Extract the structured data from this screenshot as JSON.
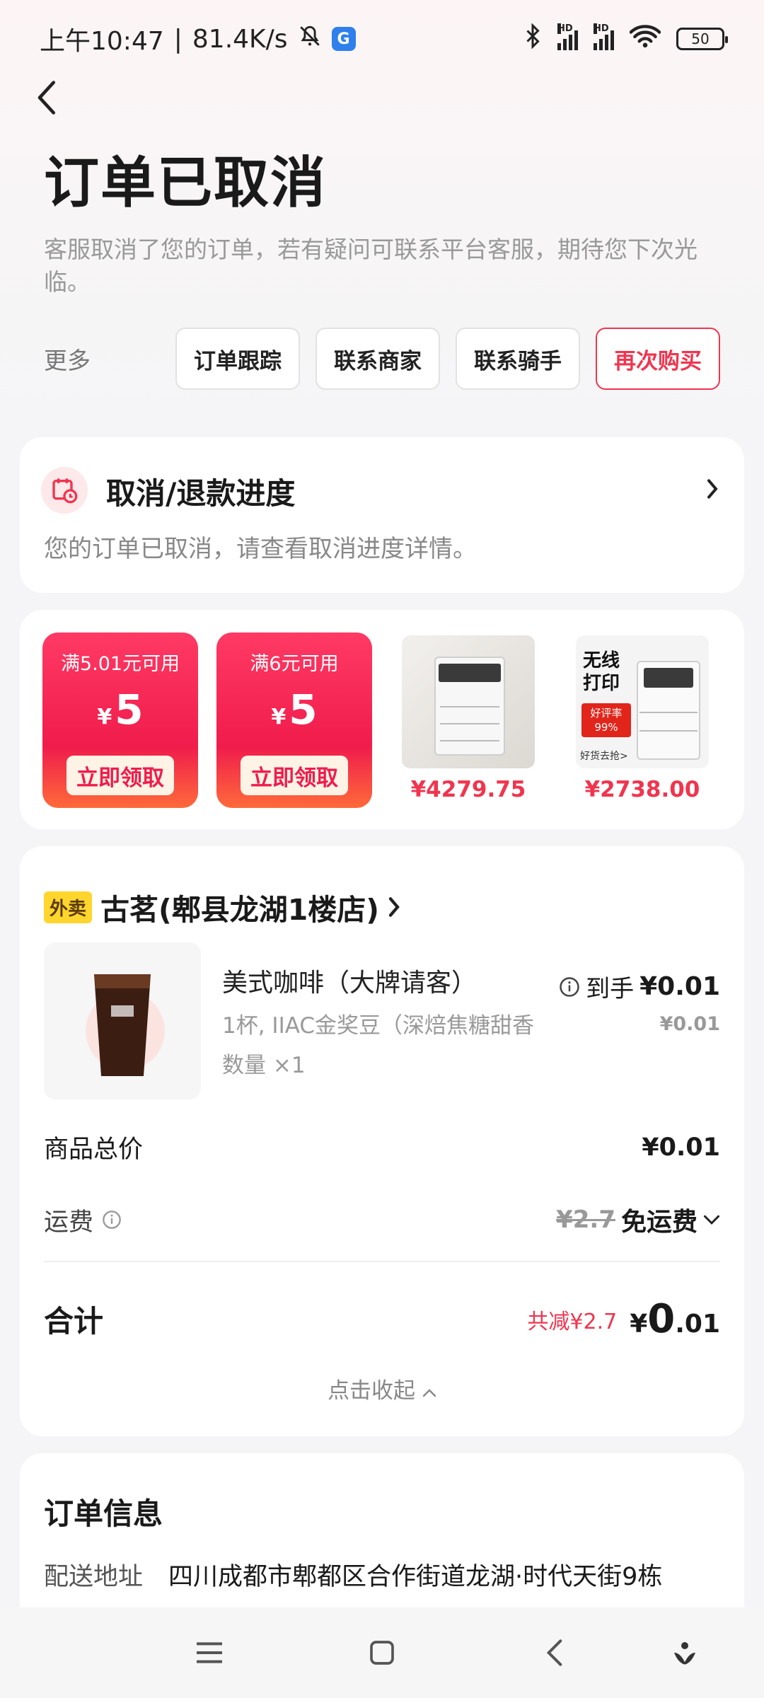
{
  "status_bar": {
    "time": "上午10:47",
    "net_speed": "81.4K/s",
    "battery": "50",
    "icons": [
      "bell-off-icon",
      "app-icon",
      "bluetooth-icon",
      "signal-hd-icon",
      "signal-hd-icon",
      "wifi-icon",
      "battery-icon"
    ]
  },
  "header": {
    "title": "订单已取消",
    "subtitle": "客服取消了您的订单，若有疑问可联系平台客服，期待您下次光临。",
    "more_label": "更多",
    "buttons": [
      "订单跟踪",
      "联系商家",
      "联系骑手",
      "再次购买"
    ]
  },
  "refund": {
    "title": "取消/退款进度",
    "desc": "您的订单已取消，请查看取消进度详情。"
  },
  "promo": {
    "coupons": [
      {
        "condition": "满5.01元可用",
        "currency": "¥",
        "amount": "5",
        "claim": "立即领取"
      },
      {
        "condition": "满6元可用",
        "currency": "¥",
        "amount": "5",
        "claim": "立即领取"
      }
    ],
    "products": [
      {
        "price": "¥4279.75"
      },
      {
        "price": "¥2738.00",
        "overlay": {
          "title": "无线打印",
          "badge": "好评率",
          "rate": "99%",
          "cta": "好货去抢>"
        }
      }
    ]
  },
  "order": {
    "tag": "外卖",
    "store": "古茗(郫县龙湖1楼店)",
    "item": {
      "name": "美式咖啡（大牌请客）",
      "spec": "1杯, IIAC金奖豆（深焙焦糖甜香",
      "qty": "数量 ×1",
      "net_label": "到手",
      "net_price": "¥0.01",
      "price": "¥0.01"
    },
    "subtotal_label": "商品总价",
    "subtotal": "¥0.01",
    "delivery_label": "运费",
    "delivery_original": "¥2.7",
    "delivery_free": "免运费",
    "total_label": "合计",
    "total_discount": "共减¥2.7",
    "total_currency": "¥",
    "total_int": "0",
    "total_dec": ".01",
    "collapse": "点击收起"
  },
  "info": {
    "title": "订单信息",
    "address_label": "配送地址",
    "address": "四川成都市郫都区合作街道龙湖·时代天街9栋"
  },
  "colors": {
    "accent": "#f0354f",
    "coupon": "#f01c4c",
    "tag": "#ffd52e"
  }
}
